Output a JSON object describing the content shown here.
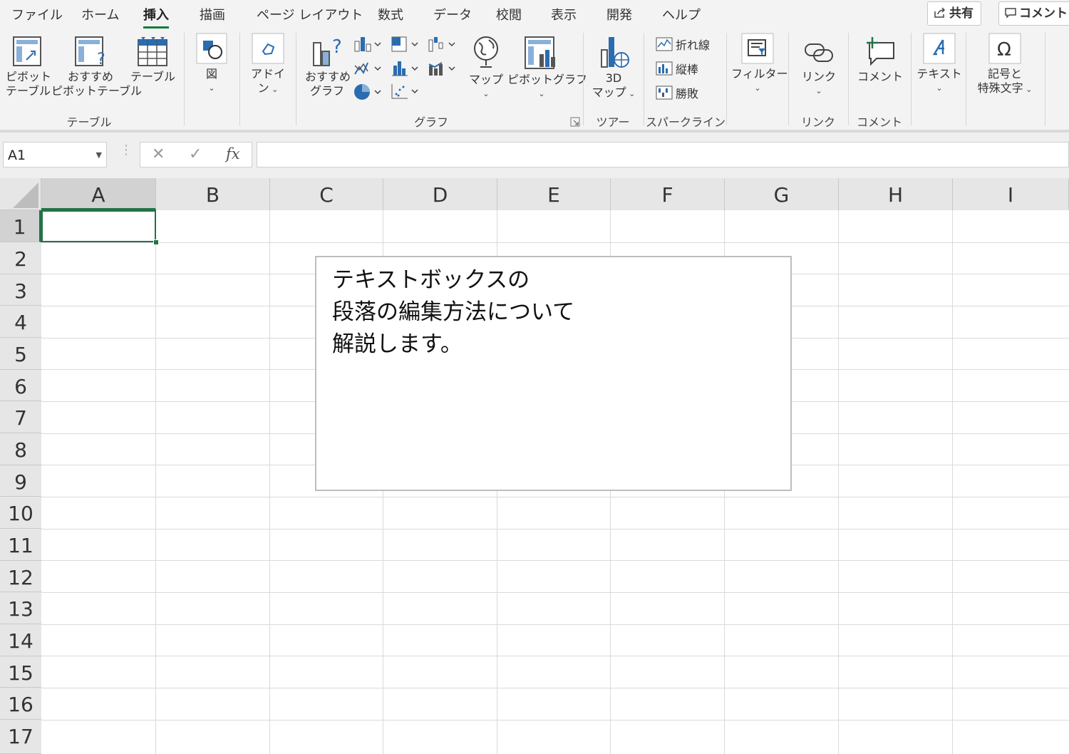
{
  "tabs": [
    "ファイル",
    "ホーム",
    "挿入",
    "描画",
    "ページ レイアウト",
    "数式",
    "データ",
    "校閲",
    "表示",
    "開発",
    "ヘルプ"
  ],
  "active_tab": "挿入",
  "header_buttons": {
    "share": "共有",
    "comment": "コメント"
  },
  "ribbon": {
    "pivot_table": [
      "ピボット",
      "テーブル"
    ],
    "recommended_pivot": [
      "おすすめ",
      "ピボットテーブル"
    ],
    "table": "テーブル",
    "group_table": "テーブル",
    "illustrations": "図",
    "addins": [
      "アドイ",
      "ン"
    ],
    "recommended_charts": [
      "おすすめ",
      "グラフ"
    ],
    "maps": "マップ",
    "pivot_chart": "ピボットグラフ",
    "group_charts": "グラフ",
    "map3d": [
      "3D",
      "マップ"
    ],
    "group_tours": "ツアー",
    "spark_line": "折れ線",
    "spark_column": "縦棒",
    "spark_winloss": "勝敗",
    "group_sparklines": "スパークライン",
    "filter": "フィルター",
    "link": "リンク",
    "group_links": "リンク",
    "comment": "コメント",
    "group_comments": "コメント",
    "text": "テキスト",
    "symbols": [
      "記号と",
      "特殊文字"
    ]
  },
  "formula_bar": {
    "name_box": "A1",
    "cancel": "✕",
    "enter": "✓",
    "fx": "fx",
    "value": ""
  },
  "columns": [
    "A",
    "B",
    "C",
    "D",
    "E",
    "F",
    "G",
    "H",
    "I"
  ],
  "rows": [
    "1",
    "2",
    "3",
    "4",
    "5",
    "6",
    "7",
    "8",
    "9",
    "10",
    "11",
    "12",
    "13",
    "14",
    "15",
    "16",
    "17"
  ],
  "selected_cell": "A1",
  "textbox_lines": [
    "テキストボックスの",
    "段落の編集方法について",
    "解説します。"
  ],
  "colors": {
    "accent": "#217346",
    "ribbon_bg": "#f3f3f3",
    "header_bg": "#e6e6e6"
  }
}
